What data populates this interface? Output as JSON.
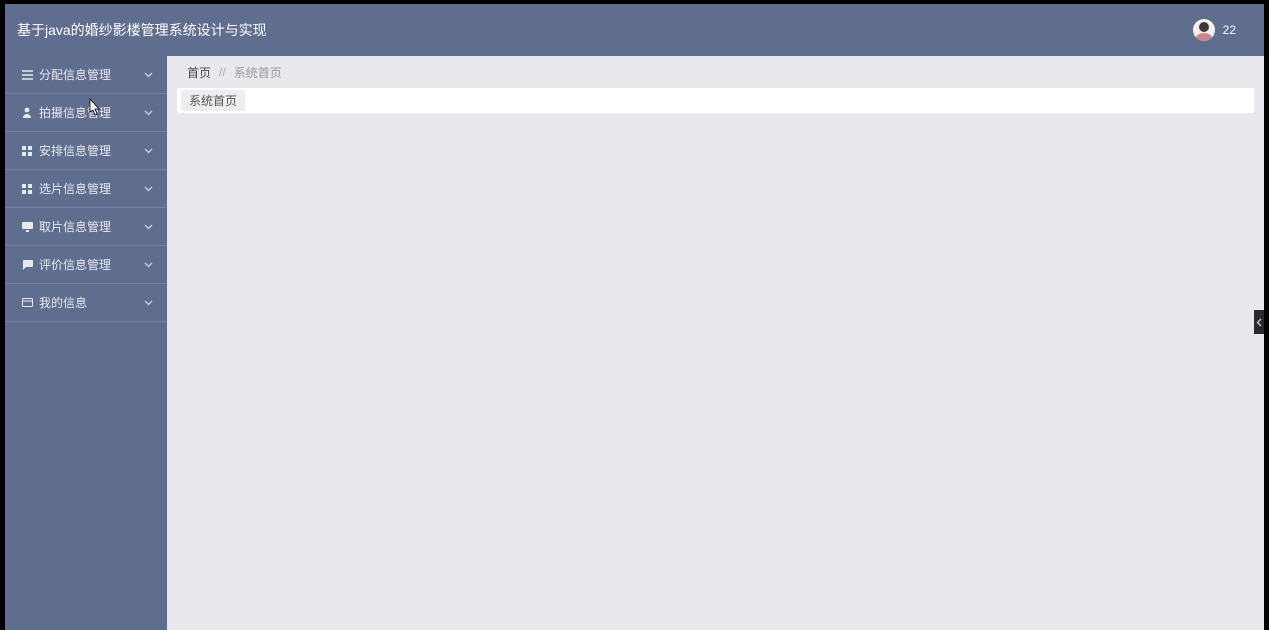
{
  "header": {
    "title": "基于java的婚纱影楼管理系统设计与实现",
    "user_badge": "22"
  },
  "sidebar": {
    "items": [
      {
        "label": "分配信息管理",
        "icon": "list"
      },
      {
        "label": "拍摄信息管理",
        "icon": "user"
      },
      {
        "label": "安排信息管理",
        "icon": "grid"
      },
      {
        "label": "选片信息管理",
        "icon": "grid"
      },
      {
        "label": "取片信息管理",
        "icon": "monitor"
      },
      {
        "label": "评价信息管理",
        "icon": "comment"
      },
      {
        "label": "我的信息",
        "icon": "card"
      }
    ]
  },
  "breadcrumb": {
    "home": "首页",
    "sep": "//",
    "current": "系统首页"
  },
  "tabs": {
    "items": [
      {
        "label": "系统首页"
      }
    ]
  }
}
